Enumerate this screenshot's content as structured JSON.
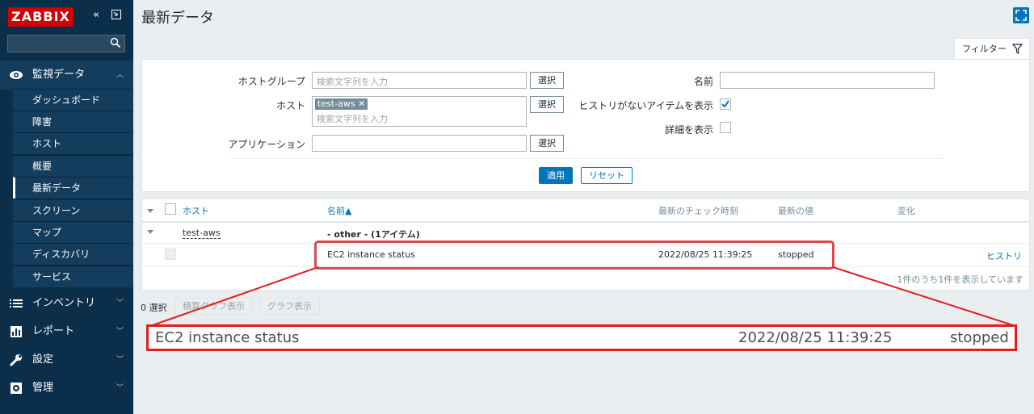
{
  "app": {
    "logo": "ZABBIX"
  },
  "sidebar": {
    "collapse_icon": "«",
    "groups": [
      {
        "label": "監視データ",
        "icon": "eye-icon"
      },
      {
        "label": "インベントリ",
        "icon": "list-icon"
      },
      {
        "label": "レポート",
        "icon": "bar-chart-icon"
      },
      {
        "label": "設定",
        "icon": "wrench-icon"
      },
      {
        "label": "管理",
        "icon": "gear-icon"
      }
    ],
    "monitoring_items": [
      {
        "label": "ダッシュボード"
      },
      {
        "label": "障害"
      },
      {
        "label": "ホスト"
      },
      {
        "label": "概要"
      },
      {
        "label": "最新データ"
      },
      {
        "label": "スクリーン"
      },
      {
        "label": "マップ"
      },
      {
        "label": "ディスカバリ"
      },
      {
        "label": "サービス"
      }
    ],
    "current_item": "最新データ"
  },
  "header": {
    "title": "最新データ"
  },
  "filter": {
    "tab_label": "フィルター",
    "host_group_label": "ホストグループ",
    "host_label": "ホスト",
    "application_label": "アプリケーション",
    "placeholder": "検索文字列を入力",
    "select_label": "選択",
    "host_tag": "test-aws",
    "name_label": "名前",
    "show_no_history_label": "ヒストリがないアイテムを表示",
    "show_no_history_checked": true,
    "show_details_label": "詳細を表示",
    "show_details_checked": false,
    "apply_label": "適用",
    "reset_label": "リセット"
  },
  "table": {
    "columns": {
      "host": "ホスト",
      "name": "名前▲",
      "last_check": "最新のチェック時刻",
      "last_value": "最新の値",
      "change": "変化"
    },
    "host_row": {
      "host": "test-aws",
      "group": "- other - (1アイテム)"
    },
    "item_row": {
      "name": "EC2 instance status",
      "last_check": "2022/08/25 11:39:25",
      "last_value": "stopped",
      "action": "ヒストリ"
    },
    "paging": "1件のうち1件を表示しています"
  },
  "actions": {
    "selected_count": "0 選択",
    "stacked_graph_label": "積算グラフ表示",
    "graph_label": "グラフ表示"
  },
  "zoom": {
    "name": "EC2 instance status",
    "last_check": "2022/08/25 11:39:25",
    "last_value": "stopped"
  },
  "colors": {
    "accent": "#0275b8",
    "sidebar": "#0b2e4a",
    "logo": "#d40000",
    "highlight": "#e31d1d"
  }
}
